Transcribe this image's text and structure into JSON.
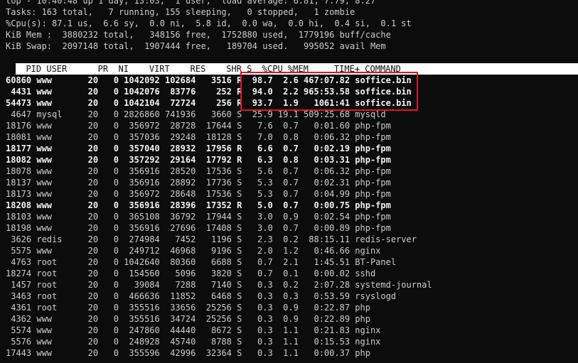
{
  "summary": {
    "top_line": "top - 10:40:48 up 1 day, 13:03,  1 user,  load average: 6.81, 7.79, 8.27",
    "tasks_line": "Tasks: 163 total,   7 running, 155 sleeping,   0 stopped,   1 zombie",
    "cpu_line": "%Cpu(s): 87.1 us,  6.6 sy,  0.0 ni,  5.8 id,  0.0 wa,  0.0 hi,  0.4 si,  0.1 st",
    "mem_line": "KiB Mem :  3880232 total,   348156 free,  1752880 used,  1779196 buff/cache",
    "swap_line": "KiB Swap:  2097148 total,  1907444 free,   189704 used.   995052 avail Mem"
  },
  "table": {
    "header": "  PID USER      PR  NI    VIRT    RES    SHR S  %CPU %MEM     TIME+ COMMAND",
    "rows": [
      {
        "text": "60860 www       20   0 1042092 102684   3516 R  98.7  2.6 467:07.82 soffice.bin",
        "bold": true
      },
      {
        "text": " 4431 www       20   0 1042076  83776    252 R  94.0  2.2 965:53.58 soffice.bin",
        "bold": true
      },
      {
        "text": "54473 www       20   0 1042104  72724    256 R  93.7  1.9   1061:41 soffice.bin",
        "bold": true
      },
      {
        "text": " 4647 mysql     20   0 2826860 741936   3660 S  25.9 19.1 509:25.68 mysqld",
        "bold": false
      },
      {
        "text": "18176 www       20   0  356972  28728  17644 S   7.6  0.7   0:01.60 php-fpm",
        "bold": false
      },
      {
        "text": "18081 www       20   0  357036  29248  18128 S   7.0  0.8   0:06.32 php-fpm",
        "bold": false
      },
      {
        "text": "18177 www       20   0  357040  28932  17956 R   6.6  0.7   0:02.19 php-fpm",
        "bold": true
      },
      {
        "text": "18082 www       20   0  357292  29164  17792 R   6.3  0.8   0:03.31 php-fpm",
        "bold": true
      },
      {
        "text": "18078 www       20   0  356916  28520  17536 S   5.6  0.7   0:06.32 php-fpm",
        "bold": false
      },
      {
        "text": "18137 www       20   0  356916  28892  17736 S   5.3  0.7   0:02.31 php-fpm",
        "bold": false
      },
      {
        "text": "18173 www       20   0  356972  28648  17536 S   5.3  0.7   0:04.99 php-fpm",
        "bold": false
      },
      {
        "text": "18208 www       20   0  356916  28396  17352 R   5.0  0.7   0:00.75 php-fpm",
        "bold": true
      },
      {
        "text": "18103 www       20   0  365108  36792  17944 S   3.0  0.9   0:02.54 php-fpm",
        "bold": false
      },
      {
        "text": "18198 www       20   0  356916  27696  17408 S   3.0  0.7   0:00.89 php-fpm",
        "bold": false
      },
      {
        "text": " 3626 redis     20   0  274984   7452   1196 S   2.3  0.2  88:15.11 redis-server",
        "bold": false
      },
      {
        "text": " 5575 www       20   0  249712  46968   9196 S   2.0  1.2   0:46.66 nginx",
        "bold": false
      },
      {
        "text": " 4763 root      20   0 1042640  80360   6688 S   0.7  2.1   1:45.51 BT-Panel",
        "bold": false
      },
      {
        "text": "18274 root      20   0  154560   5096   3820 S   0.7  0.1   0:00.02 sshd",
        "bold": false
      },
      {
        "text": " 1457 root      20   0   39084   7288   7140 S   0.3  0.2   2:07.28 systemd-journal",
        "bold": false
      },
      {
        "text": " 3463 root      20   0  466636  11852   6468 S   0.3  0.3   0:53.59 rsyslogd",
        "bold": false
      },
      {
        "text": " 4361 root      20   0  355516  33656  25256 S   0.3  0.9   0:22.87 php",
        "bold": false
      },
      {
        "text": " 4362 www       20   0  355516  34724  25256 S   0.3  0.9   0:22.89 php",
        "bold": false
      },
      {
        "text": " 5574 www       20   0  247860  44440   8672 S   0.3  1.1   0:21.83 nginx",
        "bold": false
      },
      {
        "text": " 5576 www       20   0  248928  45740   8788 S   0.3  1.1   0:15.53 nginx",
        "bold": false
      },
      {
        "text": "17443 www       20   0  355596  42996  32364 S   0.3  1.1   0:00.37 php",
        "bold": false
      }
    ]
  }
}
